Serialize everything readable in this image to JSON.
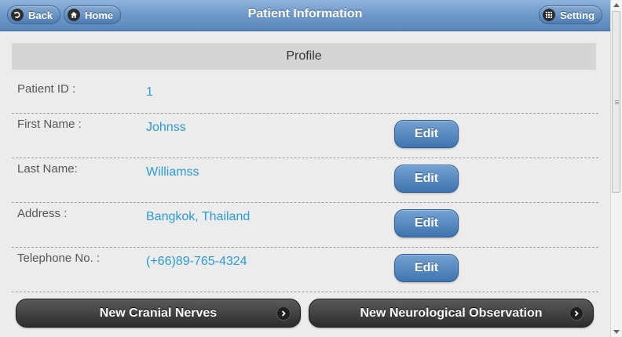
{
  "header": {
    "title": "Patient Information",
    "back_label": "Back",
    "home_label": "Home",
    "setting_label": "Setting"
  },
  "profile": {
    "section_title": "Profile",
    "fields": [
      {
        "label": "Patient ID :",
        "value": "1"
      },
      {
        "label": "First Name :",
        "value": "Johnss",
        "edit_label": "Edit"
      },
      {
        "label": "Last Name:",
        "value": "Williamss",
        "edit_label": "Edit"
      },
      {
        "label": "Address :",
        "value": "Bangkok, Thailand",
        "edit_label": "Edit"
      },
      {
        "label": "Telephone No. :",
        "value": "(+66)89-765-4324",
        "edit_label": "Edit"
      }
    ]
  },
  "actions": {
    "cranial_label": "New Cranial Nerves",
    "neuro_label": "New Neurological Observation"
  },
  "colors": {
    "header": "#6e98c8",
    "value_text": "#2a9bd3",
    "edit_button": "#3f74b0",
    "action_button": "#2c2c2c"
  },
  "icons": {
    "back": "back-arrow-icon",
    "home": "home-icon",
    "setting": "grid-icon",
    "action": "chevron-right-icon"
  }
}
